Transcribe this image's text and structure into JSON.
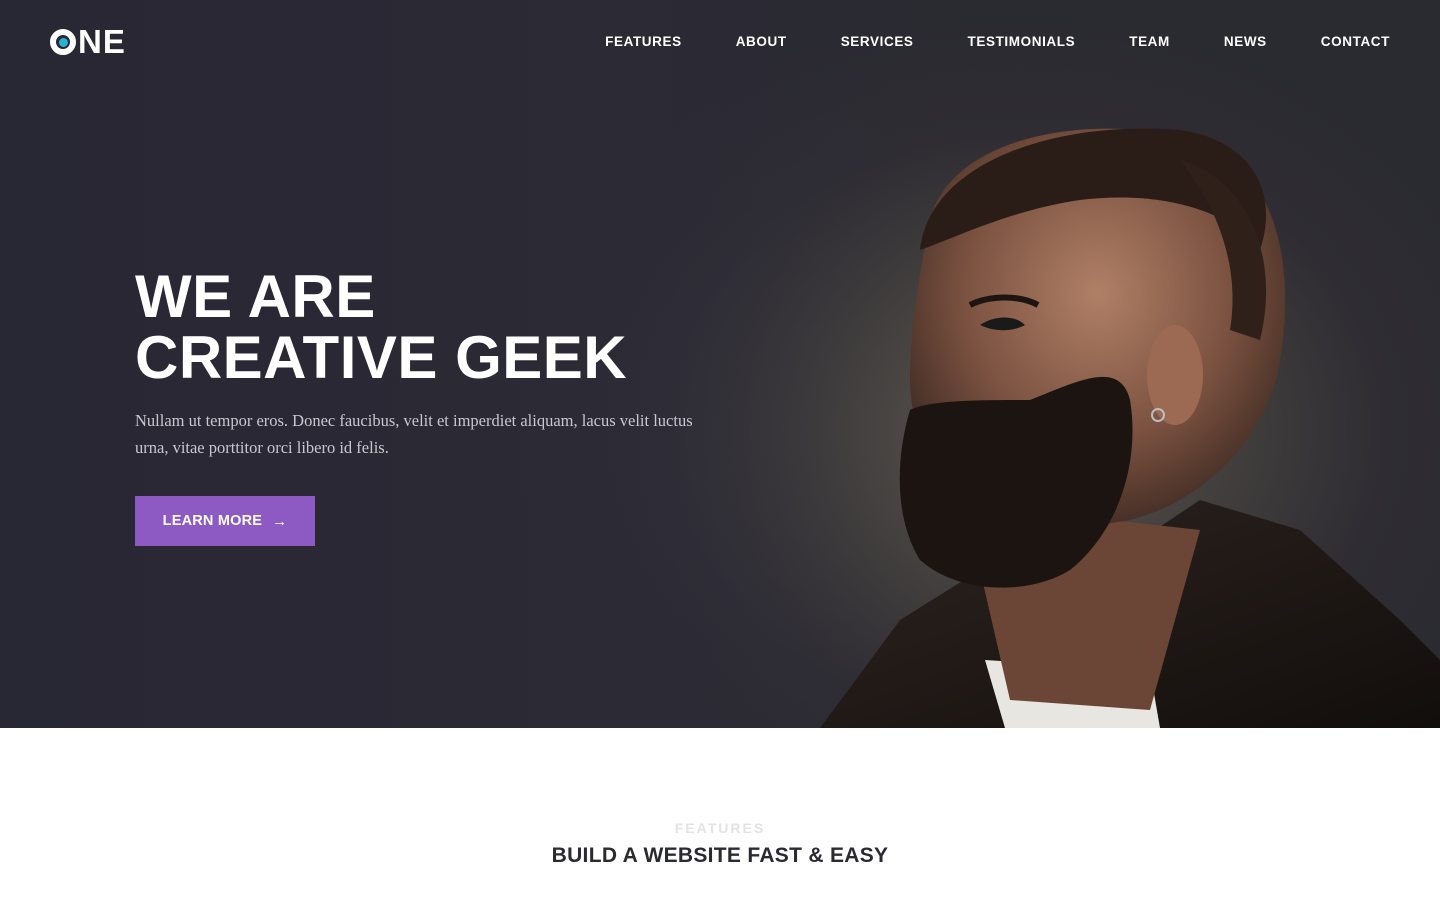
{
  "brand": {
    "logo_text": "NE",
    "accent": "#27b2d6"
  },
  "nav": {
    "items": [
      "FEATURES",
      "ABOUT",
      "SERVICES",
      "TESTIMONIALS",
      "TEAM",
      "NEWS",
      "CONTACT"
    ]
  },
  "hero": {
    "title_line1": "WE ARE",
    "title_line2": "CREATIVE GEEK",
    "text": "Nullam ut tempor eros. Donec faucibus, velit et imperdiet aliquam, lacus velit luctus urna, vitae porttitor orci libero id felis.",
    "cta_label": "LEARN MORE",
    "cta_icon": "arrow-right-icon",
    "cta_color": "#8d5ac4"
  },
  "features": {
    "eyebrow": "FEATURES",
    "title": "BUILD A WEBSITE FAST & EASY"
  }
}
